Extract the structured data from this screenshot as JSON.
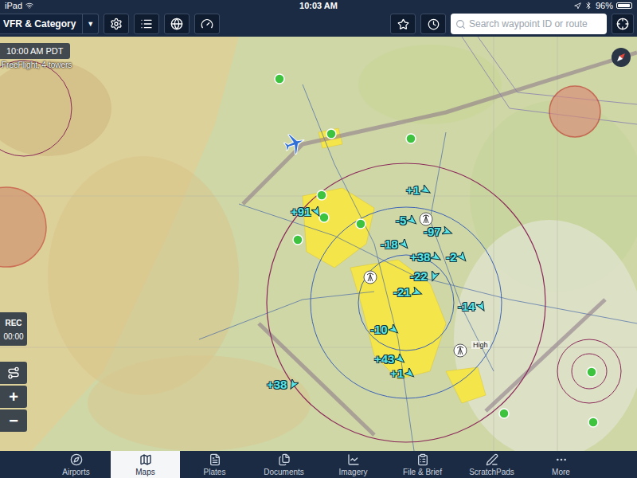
{
  "status_bar": {
    "device": "iPad",
    "time": "10:03 AM",
    "battery": "96%",
    "battery_level": 0.96
  },
  "toolbar": {
    "layer_menu": {
      "label": "VFR & Category",
      "arrow": "▼"
    },
    "search": {
      "placeholder": "Search waypoint ID or route"
    }
  },
  "map": {
    "time": "10:00 AM PDT",
    "source": "FreeFlight, 4 towers",
    "labels": [
      "High"
    ],
    "recorder": {
      "label": "REC",
      "elapsed": "00:00",
      "recording": false
    },
    "zoom": {
      "in": "+",
      "out": "−"
    },
    "traffic": [
      {
        "altitude": "+1"
      },
      {
        "altitude": "+91"
      },
      {
        "altitude": "-5"
      },
      {
        "altitude": "-97"
      },
      {
        "altitude": "-18"
      },
      {
        "altitude": "+38"
      },
      {
        "altitude": "-2"
      },
      {
        "altitude": "-22"
      },
      {
        "altitude": "-21"
      },
      {
        "altitude": "-14"
      },
      {
        "altitude": "-10"
      },
      {
        "altitude": "+43"
      },
      {
        "altitude": "+1"
      },
      {
        "altitude": "+38"
      }
    ]
  },
  "tabs": [
    {
      "label": "Airports",
      "selected": false
    },
    {
      "label": "Maps",
      "selected": true
    },
    {
      "label": "Plates",
      "selected": false
    },
    {
      "label": "Documents",
      "selected": false
    },
    {
      "label": "Imagery",
      "selected": false
    },
    {
      "label": "File & Brief",
      "selected": false
    },
    {
      "label": "ScratchPads",
      "selected": false
    },
    {
      "label": "More",
      "selected": false
    }
  ]
}
